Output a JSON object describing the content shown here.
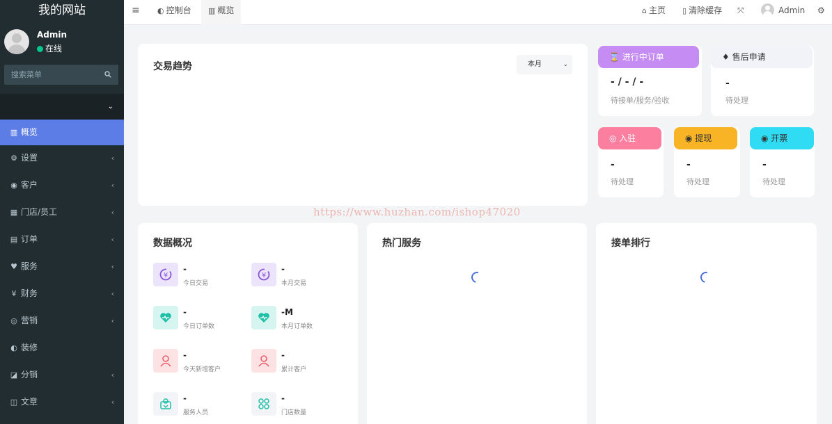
{
  "sidebar": {
    "site_title": "我的网站",
    "user_name": "Admin",
    "user_status": "在线",
    "search_placeholder": "搜索菜单",
    "items": [
      {
        "label": "概览",
        "icon": "bar-chart-icon",
        "glyph": "▥",
        "active": true
      },
      {
        "label": "设置",
        "icon": "gear-icon",
        "glyph": "⚙"
      },
      {
        "label": "客户",
        "icon": "user-circle-icon",
        "glyph": "◉"
      },
      {
        "label": "门店/员工",
        "icon": "bank-icon",
        "glyph": "▦"
      },
      {
        "label": "订单",
        "icon": "file-icon",
        "glyph": "▤"
      },
      {
        "label": "服务",
        "icon": "heartbeat-icon",
        "glyph": "♥"
      },
      {
        "label": "财务",
        "icon": "yen-icon",
        "glyph": "¥"
      },
      {
        "label": "营销",
        "icon": "wechat-icon",
        "glyph": "◎"
      },
      {
        "label": "装修",
        "icon": "dashboard-icon",
        "glyph": "◐"
      },
      {
        "label": "分销",
        "icon": "share-square-icon",
        "glyph": "◪"
      },
      {
        "label": "文章",
        "icon": "columns-icon",
        "glyph": "◫"
      }
    ]
  },
  "topbar": {
    "tabs": [
      {
        "label": "控制台",
        "icon": "dashboard-icon",
        "glyph": "◐"
      },
      {
        "label": "概览",
        "icon": "bar-chart-icon",
        "glyph": "▥"
      }
    ],
    "home_label": "主页",
    "clear_cache_label": "清除缓存",
    "admin_name": "Admin"
  },
  "trend": {
    "title": "交易趋势",
    "period": "本月"
  },
  "stats": {
    "in_progress": {
      "title": "进行中订单",
      "value": "- / - / -",
      "sub": "待接单/服务/验收",
      "color": "#c58cf4",
      "icon": "hourglass-icon"
    },
    "after_sale": {
      "title": "售后申请",
      "value": "-",
      "sub": "待处理",
      "color": "#f2f3f9",
      "icon": "support-icon"
    },
    "settle": {
      "title": "入驻",
      "value": "-",
      "sub": "待处理",
      "color": "#fc7fa0",
      "icon": "check-circle-icon"
    },
    "withdraw": {
      "title": "提现",
      "value": "-",
      "sub": "待处理",
      "color": "#f8b425",
      "icon": "yen-circle-icon"
    },
    "invoice": {
      "title": "开票",
      "value": "-",
      "sub": "待处理",
      "color": "#2fdcf3",
      "icon": "yen-circle-icon"
    }
  },
  "overview": {
    "title": "数据概况",
    "items": [
      {
        "value": "-",
        "label": "今日交易",
        "icon": "yen-exchange-icon",
        "bg": "#ece4fb",
        "fg": "#8a55d8"
      },
      {
        "value": "-",
        "label": "本月交易",
        "icon": "yen-exchange-icon",
        "bg": "#ece4fb",
        "fg": "#8a55d8"
      },
      {
        "value": "-",
        "label": "今日订单数",
        "icon": "heart-icon",
        "bg": "#d6f5f0",
        "fg": "#1fbfa8"
      },
      {
        "value": "-M",
        "label": "本月订单数",
        "icon": "heart-icon",
        "bg": "#d6f5f0",
        "fg": "#1fbfa8"
      },
      {
        "value": "-",
        "label": "今天新增客户",
        "icon": "user-icon",
        "bg": "#fde2e4",
        "fg": "#ec5f6e"
      },
      {
        "value": "-",
        "label": "累计客户",
        "icon": "user-icon",
        "bg": "#fde2e4",
        "fg": "#ec5f6e"
      },
      {
        "value": "-",
        "label": "服务人员",
        "icon": "staff-icon",
        "bg": "#f2f4f8",
        "fg": "#1fbfa8"
      },
      {
        "value": "-",
        "label": "门店数量",
        "icon": "grid-icon",
        "bg": "#f2f4f8",
        "fg": "#1fbfa8"
      }
    ]
  },
  "hot_services": {
    "title": "热门服务"
  },
  "ranking": {
    "title": "接单排行"
  },
  "watermark": "https://www.huzhan.com/ishop47020"
}
